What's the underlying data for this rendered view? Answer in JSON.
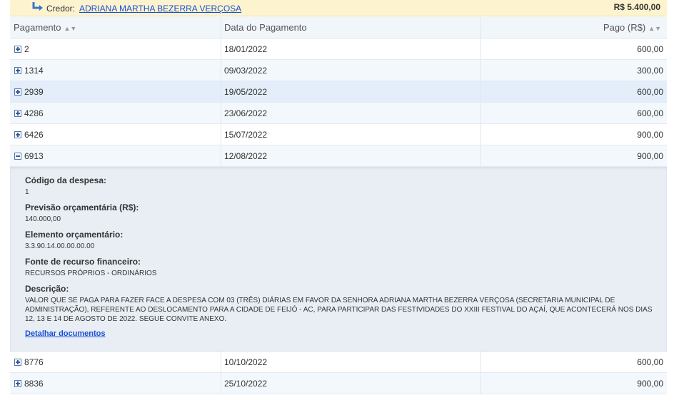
{
  "credor": {
    "label": "Credor:",
    "name": "ADRIANA MARTHA BEZERRA VERÇOSA",
    "total": "R$ 5.400,00"
  },
  "table": {
    "headers": {
      "pagamento": "Pagamento",
      "data": "Data do Pagamento",
      "pago": "Pago (R$)"
    },
    "rows_before": [
      {
        "pagamento": "2",
        "data": "18/01/2022",
        "pago": "600,00"
      },
      {
        "pagamento": "1314",
        "data": "09/03/2022",
        "pago": "300,00"
      },
      {
        "pagamento": "2939",
        "data": "19/05/2022",
        "pago": "600,00"
      },
      {
        "pagamento": "4286",
        "data": "23/06/2022",
        "pago": "600,00"
      },
      {
        "pagamento": "6426",
        "data": "15/07/2022",
        "pago": "900,00"
      },
      {
        "pagamento": "6913",
        "data": "12/08/2022",
        "pago": "900,00"
      }
    ],
    "expanded": {
      "codigo_label": "Código da despesa:",
      "codigo_value": "1",
      "previsao_label": "Previsão orçamentária (R$):",
      "previsao_value": "140.000,00",
      "elemento_label": "Elemento orçamentário:",
      "elemento_value": "3.3.90.14.00.00.00.00",
      "fonte_label": "Fonte de recurso financeiro:",
      "fonte_value": "RECURSOS PRÓPRIOS - ORDINÁRIOS",
      "descricao_label": "Descrição:",
      "descricao_value": "VALOR QUE SE PAGA PARA FAZER FACE A DESPESA COM 03 (TRÊS) DIÁRIAS EM FAVOR DA SENHORA ADRIANA MARTHA BEZERRA VERÇOSA (SECRETARIA MUNICIPAL DE ADMINISTRAÇÃO), REFERENTE AO DESLOCAMENTO PARA A CIDADE DE FEIJÓ - AC, PARA PARTICIPAR DAS FESTIVIDADES DO XXIII FESTIVAL DO AÇAÍ, QUE ACONTECERÁ NOS DIAS 12, 13 E 14 DE AGOSTO DE 2022. SEGUE CONVITE ANEXO.",
      "detalhar_link": "Detalhar documentos"
    },
    "rows_after": [
      {
        "pagamento": "8776",
        "data": "10/10/2022",
        "pago": "600,00"
      },
      {
        "pagamento": "8836",
        "data": "25/10/2022",
        "pago": "900,00"
      }
    ]
  }
}
